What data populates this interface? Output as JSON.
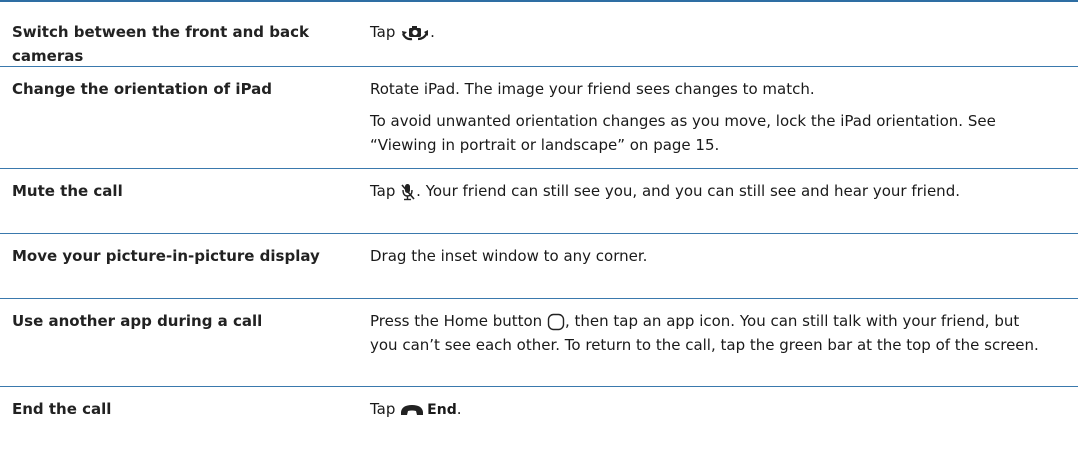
{
  "rows": [
    {
      "action": "Switch between the front and back cameras",
      "desc": {
        "pre": "Tap ",
        "icon": "switch-camera-icon",
        "post": "."
      }
    },
    {
      "action": "Change the orientation of iPad",
      "p1": "Rotate iPad. The image your friend sees changes to match.",
      "p2": "To avoid unwanted orientation changes as you move, lock the iPad orientation. See “Viewing in portrait or landscape” on page 15."
    },
    {
      "action": "Mute the call",
      "desc": {
        "pre": "Tap ",
        "icon": "mute-microphone-icon",
        "post": ". Your friend can still see you, and you can still see and hear your friend."
      }
    },
    {
      "action": "Move your picture-in-picture display",
      "p1": "Drag the inset window to any corner."
    },
    {
      "action": "Use another app during a call",
      "desc": {
        "pre": "Press the Home button ",
        "icon": "home-button-icon",
        "post": ", then tap an app icon. You can still talk with your friend, but you can’t see each other. To return to the call, tap the green bar at the top of the screen."
      }
    },
    {
      "action": "End the call",
      "desc": {
        "pre": "Tap ",
        "icon": "end-call-icon",
        "end_label": "End",
        "post": "."
      }
    }
  ],
  "colors": {
    "rule": "#3a79ad",
    "text": "#1a1a1a"
  }
}
